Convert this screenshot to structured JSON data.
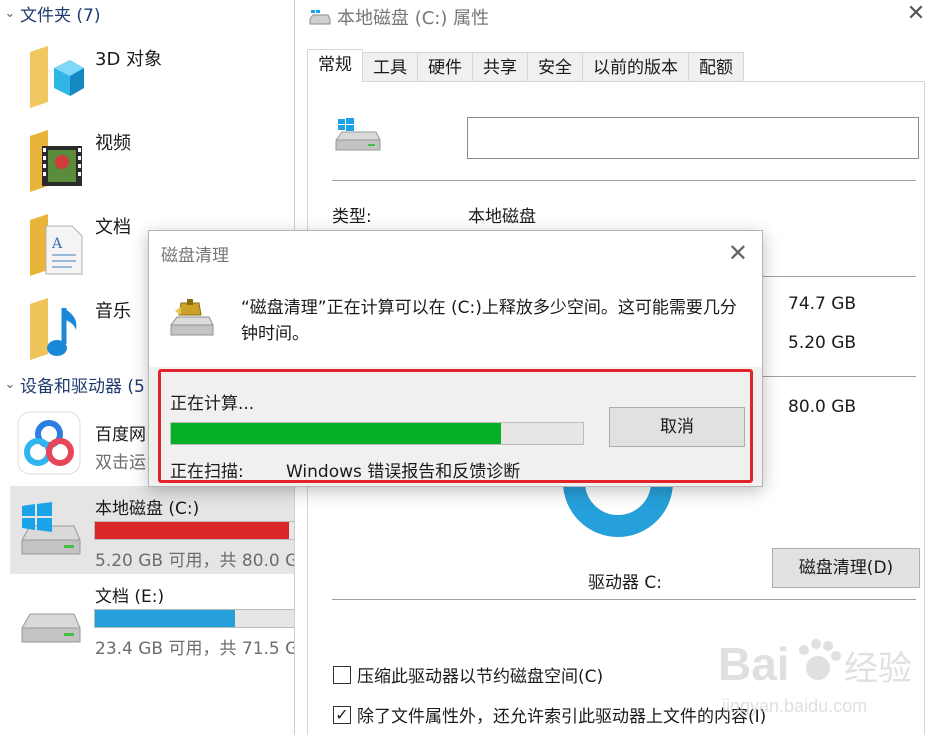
{
  "explorer": {
    "folders_header": "文件夹 (7)",
    "folders": [
      {
        "name": "3D 对象",
        "icon": "3d-objects-folder-icon"
      },
      {
        "name": "视频",
        "icon": "video-folder-icon"
      },
      {
        "name": "文档",
        "icon": "documents-folder-icon"
      },
      {
        "name": "音乐",
        "icon": "music-folder-icon"
      }
    ],
    "devices_header": "设备和驱动器 (5",
    "drives": [
      {
        "name": "百度网",
        "sub": "双击运",
        "icon": "baidu-netdisk-icon"
      },
      {
        "name": "本地磁盘 (C:)",
        "sub": "5.20 GB 可用，共 80.0 G",
        "used_fraction": 0.935,
        "bar_color": "#da2626",
        "icon": "windows-drive-icon"
      },
      {
        "name": "文档 (E:)",
        "sub": "23.4 GB 可用，共 71.5 G",
        "used_fraction": 0.673,
        "bar_color": "#26a0da",
        "icon": "drive-icon"
      }
    ]
  },
  "properties": {
    "title": "本地磁盘 (C:) 属性",
    "tabs": [
      "常规",
      "工具",
      "硬件",
      "共享",
      "安全",
      "以前的版本",
      "配额"
    ],
    "active_tab": "常规",
    "name_value": "",
    "type_label": "类型:",
    "type_value": "本地磁盘",
    "used_value": "74.7 GB",
    "free_value": "5.20 GB",
    "capacity_value": "80.0 GB",
    "drive_label": "驱动器 C:",
    "cleanup_button": "磁盘清理(D)",
    "compress_label": "压缩此驱动器以节约磁盘空间(C)",
    "compress_checked": false,
    "index_label": "除了文件属性外，还允许索引此驱动器上文件的内容(I)",
    "index_checked": true,
    "check_mark": "✓",
    "close_glyph": "✕"
  },
  "cleanup_dialog": {
    "title": "磁盘清理",
    "message": "“磁盘清理”正在计算可以在 (C:)上释放多少空间。这可能需要几分钟时间。",
    "calculating": "正在计算...",
    "progress": 0.8,
    "cancel": "取消",
    "scanning_label": "正在扫描:",
    "scanning_value": "Windows 错误报告和反馈诊断",
    "close_glyph": "✕"
  },
  "watermark": {
    "brand_left": "Bai",
    "brand_right": "经验",
    "url": "jingyan.baidu.com"
  },
  "colors": {
    "accent_blue": "#26a0da",
    "danger_red": "#da2626",
    "progress_green": "#06b025",
    "highlight_box": "#e0242a"
  }
}
